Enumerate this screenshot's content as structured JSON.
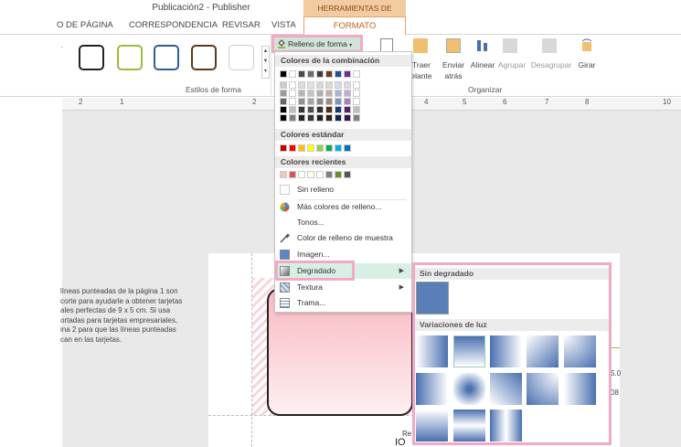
{
  "window": {
    "title": "Publicación2 - Publisher",
    "context_tab": "HERRAMIENTAS DE DIBUJO"
  },
  "tabs": {
    "pagina": "O DE PÁGINA",
    "correspondencia": "CORRESPONDENCIA",
    "revisar": "REVISAR",
    "vista": "VISTA",
    "formato": "FORMATO"
  },
  "ribbon": {
    "group_styles_label": "Estilos de forma",
    "fill_button": "Relleno de forma",
    "bring_forward_1": "Traer",
    "bring_forward_2": "elante",
    "send_back_1": "Enviar",
    "send_back_2": "atrás",
    "align": "Alinear",
    "group": "Agrupar",
    "ungroup": "Desagrupar",
    "rotate": "Girar",
    "group_arrange_label": "Organizar"
  },
  "ruler": {
    "n2": "2",
    "n1": "1",
    "n2b": "2",
    "n4": "4",
    "n5": "5",
    "n6": "6",
    "n7": "7",
    "n8": "8",
    "n10": "10"
  },
  "notes": {
    "line1": "líneas punteadas de la página 1 son",
    "line2": "corte para ayudarle a obtener tarjetas",
    "line3": "ales perfectas de 9 x 5 cm. Si usa",
    "line4": "ortadas para tarjetas empresariales,",
    "line5": "ina 2 para que las líneas punteadas",
    "line6": "can en las tarjetas."
  },
  "fill_menu": {
    "theme_colors": "Colores de la combinación",
    "standard_colors": "Colores estándar",
    "recent_colors": "Colores recientes",
    "no_fill": "Sin relleno",
    "more_colors": "Más colores de relleno...",
    "tints": "Tonos...",
    "sample_color": "Color de relleno de muestra",
    "image": "Imagen...",
    "gradient": "Degradado",
    "texture": "Textura",
    "pattern": "Trama..."
  },
  "gradient_menu": {
    "no_gradient": "Sin degradado",
    "light_variations": "Variaciones de luz"
  },
  "canvas_text": {
    "re": "Re",
    "partial": "IO",
    "right1": "5.0",
    "right2": "08"
  },
  "colors": {
    "theme_top": [
      "#000000",
      "#ffffff",
      "#4a4a4a",
      "#6b6b6b",
      "#3d3d3d",
      "#6a3d1e",
      "#1f4e9c",
      "#6f2c91",
      "#ffffff"
    ],
    "standard": [
      "#c00000",
      "#ff0000",
      "#ffc000",
      "#ffff00",
      "#92d050",
      "#00b050",
      "#00b0f0",
      "#0070c0"
    ],
    "recent": [
      "#f4c7b5",
      "#e05050",
      "#ffffff",
      "#ffffe0",
      "#ffffff",
      "#808080",
      "#6b8e23",
      "#555555"
    ],
    "accent_pink": "#f3a9c6",
    "gradient_blue": "#5a7fb8"
  }
}
